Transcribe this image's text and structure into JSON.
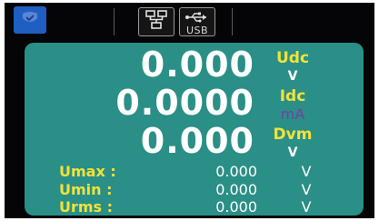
{
  "topbar": {
    "status_icon": "shield-check-icon",
    "network_icon": "network-tree-icon",
    "usb_label": "USB"
  },
  "readings": {
    "main": [
      {
        "value": "0.000",
        "unit": "Udc",
        "sub_unit": "V"
      },
      {
        "value": "0.0000",
        "unit": "Idc",
        "sub_unit": "mA"
      },
      {
        "value": "0.000",
        "unit": "Dvm",
        "sub_unit": "V"
      }
    ],
    "stats": [
      {
        "label": "Umax :",
        "value": "0.000",
        "unit": "V"
      },
      {
        "label": "Umin :",
        "value": "0.000",
        "unit": "V"
      },
      {
        "label": "Urms :",
        "value": "0.000",
        "unit": "V"
      }
    ]
  },
  "colors": {
    "panel": "#2a8f86",
    "label_yellow": "#f3e23a",
    "unit_purple": "#7a3ca8",
    "badge_blue": "#1f5fc2"
  }
}
